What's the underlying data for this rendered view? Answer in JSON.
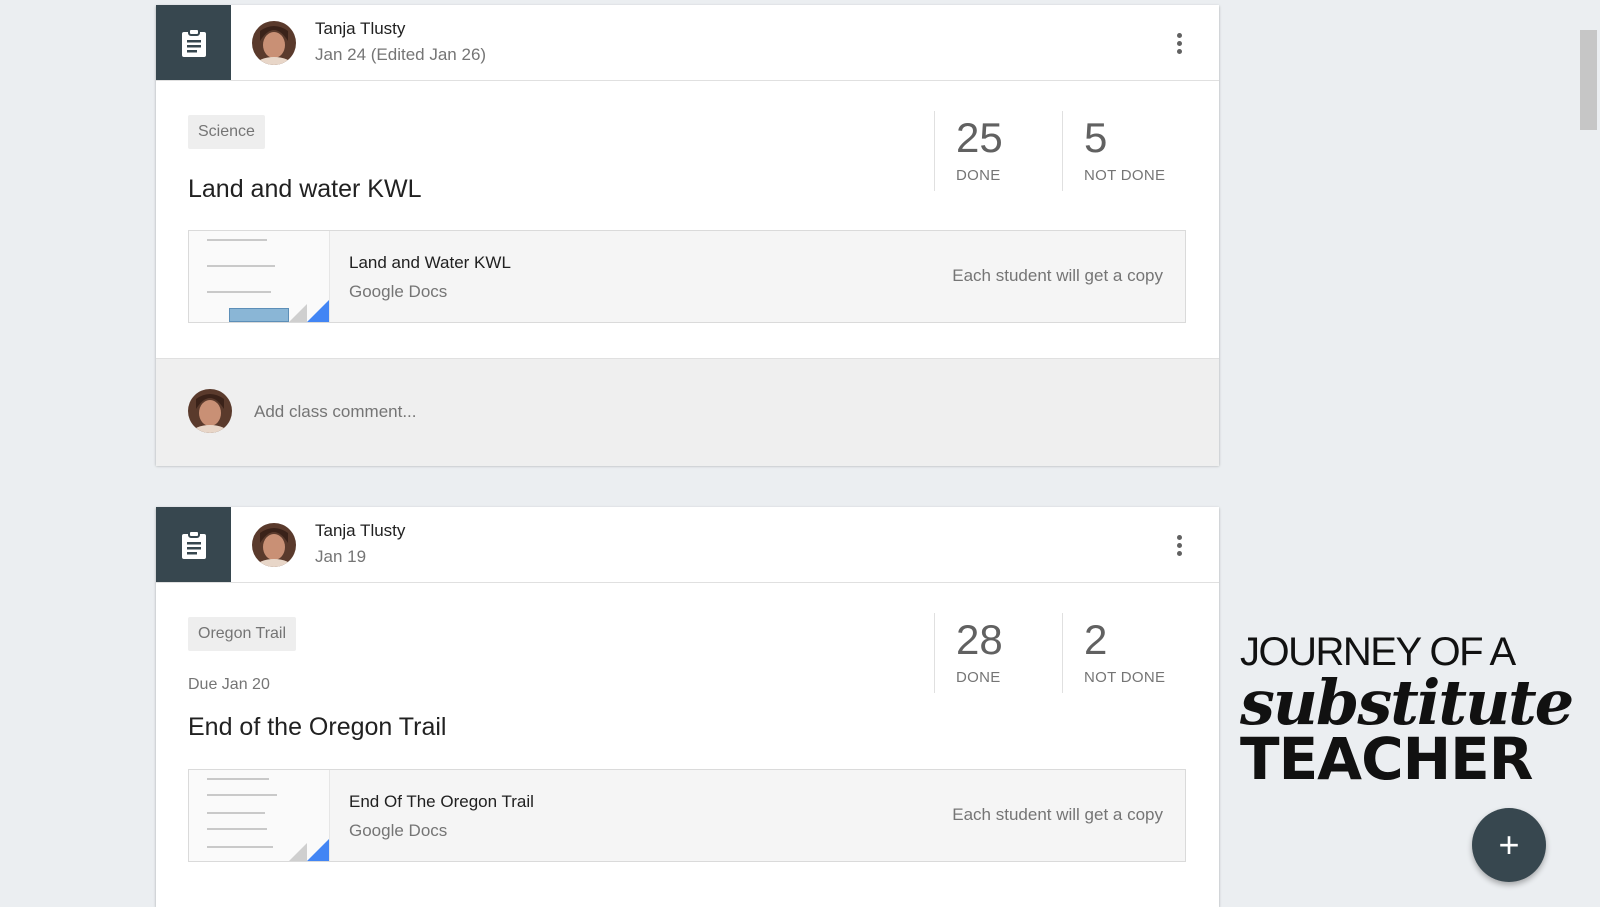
{
  "posts": [
    {
      "author": "Tanja Tlusty",
      "date": "Jan 24 (Edited Jan 26)",
      "topic": "Science",
      "due": "",
      "title": "Land and water KWL",
      "done_count": "25",
      "done_label": "DONE",
      "not_done_count": "5",
      "not_done_label": "NOT DONE",
      "attachment": {
        "name": "Land and Water KWL",
        "type": "Google Docs",
        "note": "Each student will get a copy"
      },
      "comment_placeholder": "Add class comment..."
    },
    {
      "author": "Tanja Tlusty",
      "date": "Jan 19",
      "topic": "Oregon Trail",
      "due": "Due Jan 20",
      "title": "End of the Oregon Trail",
      "done_count": "28",
      "done_label": "DONE",
      "not_done_count": "2",
      "not_done_label": "NOT DONE",
      "attachment": {
        "name": "End Of The Oregon Trail",
        "type": "Google Docs",
        "note": "Each student will get a copy"
      }
    }
  ],
  "brand": {
    "line1": "JOURNEY OF A",
    "line2": "substitute",
    "line3": "TEACHER"
  },
  "fab_label": "+",
  "colors": {
    "header_tile": "#37474f",
    "doc_corner": "#4285f4",
    "background": "#ebeef1"
  },
  "icons": {
    "assignment": "assignment-icon",
    "more": "more-vert-icon",
    "add": "add-icon"
  }
}
